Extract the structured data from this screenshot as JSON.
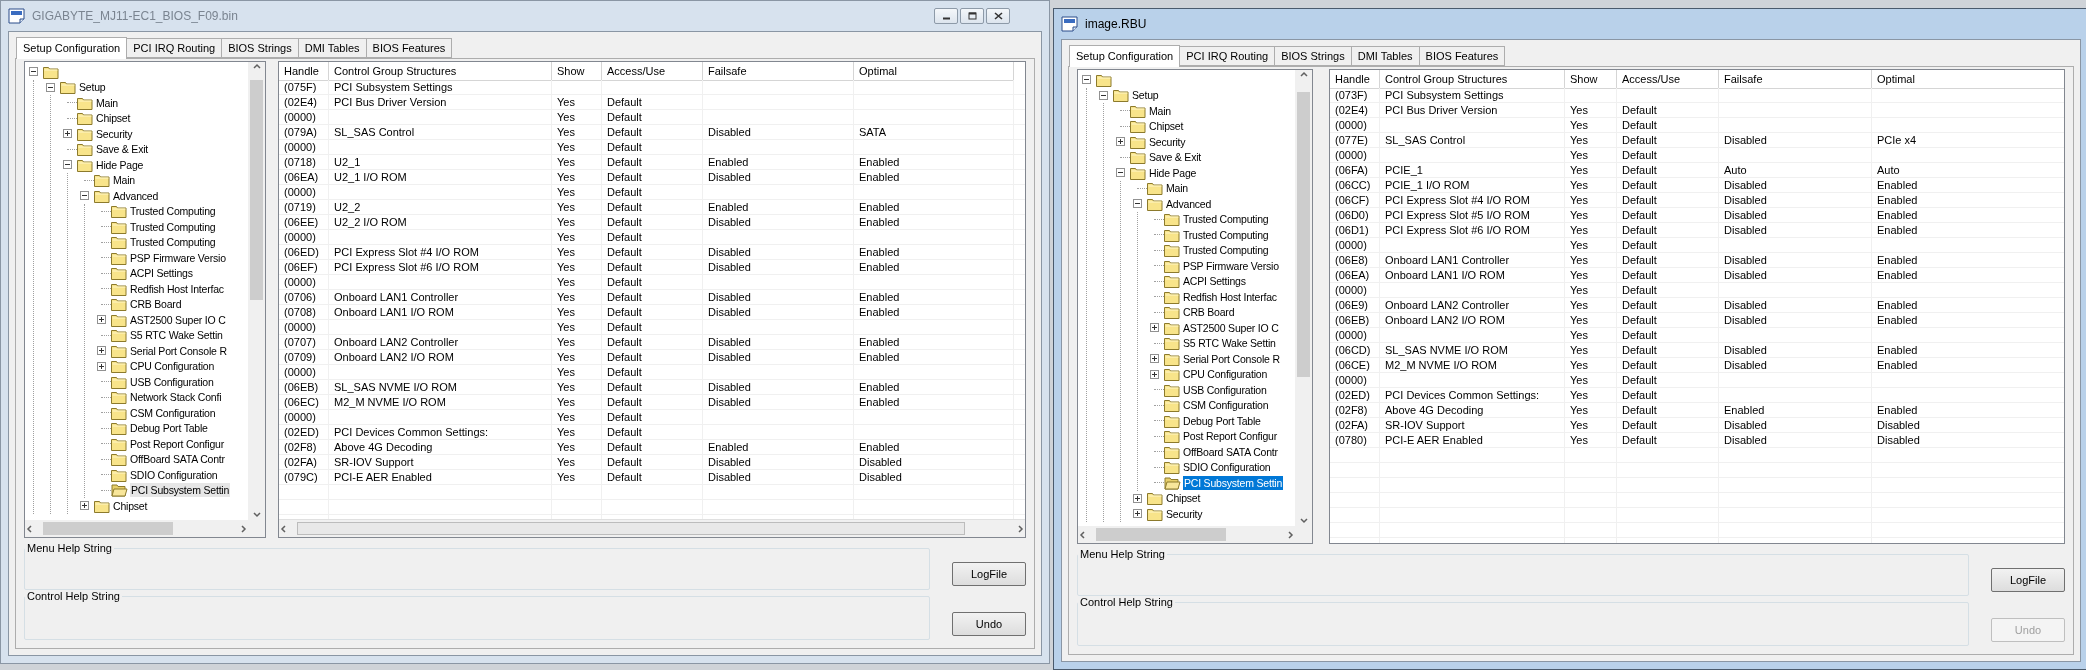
{
  "windows": [
    {
      "title": "GIGABYTE_MJ11-EC1_BIOS_F09.bin",
      "active": false,
      "has_controls": true,
      "horizontal_scrollbar": true,
      "tabs": [
        {
          "label": "Setup Configuration",
          "selected": true
        },
        {
          "label": "PCI IRQ Routing",
          "selected": false
        },
        {
          "label": "BIOS Strings",
          "selected": false
        },
        {
          "label": "DMI Tables",
          "selected": false
        },
        {
          "label": "BIOS Features",
          "selected": false
        }
      ],
      "tree": [
        {
          "selected": false,
          "expanded": true,
          "children": [
            {
              "label": "Setup",
              "selected": false,
              "expanded": true,
              "children": [
                {
                  "label": "Main",
                  "selected": false
                },
                {
                  "label": "Chipset",
                  "selected": false
                },
                {
                  "label": "Security",
                  "selected": false,
                  "expanded": false
                },
                {
                  "label": "Save & Exit",
                  "selected": false
                },
                {
                  "label": "Hide Page",
                  "selected": false,
                  "expanded": true,
                  "children": [
                    {
                      "label": "Main",
                      "selected": false
                    },
                    {
                      "label": "Advanced",
                      "selected": false,
                      "expanded": true,
                      "children": [
                        {
                          "label": "Trusted Computing",
                          "selected": false
                        },
                        {
                          "label": "Trusted Computing",
                          "selected": false
                        },
                        {
                          "label": "Trusted Computing",
                          "selected": false
                        },
                        {
                          "label": "PSP Firmware Versio",
                          "selected": false
                        },
                        {
                          "label": "ACPI Settings",
                          "selected": false
                        },
                        {
                          "label": "Redfish Host Interfac",
                          "selected": false
                        },
                        {
                          "label": "CRB Board",
                          "selected": false
                        },
                        {
                          "label": "AST2500 Super IO C",
                          "selected": false,
                          "expanded": false
                        },
                        {
                          "label": "S5 RTC Wake Settin",
                          "selected": false
                        },
                        {
                          "label": "Serial Port Console R",
                          "selected": false,
                          "expanded": false
                        },
                        {
                          "label": "CPU Configuration",
                          "selected": false,
                          "expanded": false
                        },
                        {
                          "label": "USB Configuration",
                          "selected": false
                        },
                        {
                          "label": "Network Stack Confi",
                          "selected": false
                        },
                        {
                          "label": "CSM Configuration",
                          "selected": false
                        },
                        {
                          "label": "Debug Port Table",
                          "selected": false
                        },
                        {
                          "label": "Post Report Configur",
                          "selected": false
                        },
                        {
                          "label": "OffBoard SATA Contr",
                          "selected": false
                        },
                        {
                          "label": "SDIO Configuration",
                          "selected": false
                        },
                        {
                          "label": "PCI Subsystem Settin",
                          "selected": true
                        }
                      ]
                    },
                    {
                      "label": "Chipset",
                      "selected": false,
                      "expanded": false
                    }
                  ]
                }
              ]
            }
          ]
        }
      ],
      "table": {
        "columns": [
          "Handle",
          "Control Group Structures",
          "Show",
          "Access/Use",
          "Failsafe",
          "Optimal"
        ],
        "rows": [
          {
            "handle": "(075F)",
            "structure": "PCI Subsystem Settings"
          },
          {
            "handle": "(02E4)",
            "structure": "PCI Bus Driver Version",
            "show": "Yes",
            "access": "Default"
          },
          {
            "handle": "(0000)",
            "show": "Yes",
            "access": "Default"
          },
          {
            "handle": "(079A)",
            "structure": "SL_SAS Control",
            "show": "Yes",
            "access": "Default",
            "failsafe": "Disabled",
            "optimal": "SATA"
          },
          {
            "handle": "(0000)",
            "show": "Yes",
            "access": "Default"
          },
          {
            "handle": "(0718)",
            "structure": "U2_1",
            "show": "Yes",
            "access": "Default",
            "failsafe": "Enabled",
            "optimal": "Enabled"
          },
          {
            "handle": "(06EA)",
            "structure": "U2_1 I/O ROM",
            "show": "Yes",
            "access": "Default",
            "failsafe": "Disabled",
            "optimal": "Enabled"
          },
          {
            "handle": "(0000)",
            "show": "Yes",
            "access": "Default"
          },
          {
            "handle": "(0719)",
            "structure": "U2_2",
            "show": "Yes",
            "access": "Default",
            "failsafe": "Enabled",
            "optimal": "Enabled"
          },
          {
            "handle": "(06EE)",
            "structure": "U2_2 I/O ROM",
            "show": "Yes",
            "access": "Default",
            "failsafe": "Disabled",
            "optimal": "Enabled"
          },
          {
            "handle": "(0000)",
            "show": "Yes",
            "access": "Default"
          },
          {
            "handle": "(06ED)",
            "structure": "PCI Express Slot #4 I/O ROM",
            "show": "Yes",
            "access": "Default",
            "failsafe": "Disabled",
            "optimal": "Enabled"
          },
          {
            "handle": "(06EF)",
            "structure": "PCI Express Slot #6 I/O ROM",
            "show": "Yes",
            "access": "Default",
            "failsafe": "Disabled",
            "optimal": "Enabled"
          },
          {
            "handle": "(0000)",
            "show": "Yes",
            "access": "Default"
          },
          {
            "handle": "(0706)",
            "structure": "Onboard LAN1 Controller",
            "show": "Yes",
            "access": "Default",
            "failsafe": "Disabled",
            "optimal": "Enabled"
          },
          {
            "handle": "(0708)",
            "structure": "Onboard LAN1 I/O ROM",
            "show": "Yes",
            "access": "Default",
            "failsafe": "Disabled",
            "optimal": "Enabled"
          },
          {
            "handle": "(0000)",
            "show": "Yes",
            "access": "Default"
          },
          {
            "handle": "(0707)",
            "structure": "Onboard LAN2 Controller",
            "show": "Yes",
            "access": "Default",
            "failsafe": "Disabled",
            "optimal": "Enabled"
          },
          {
            "handle": "(0709)",
            "structure": "Onboard LAN2 I/O ROM",
            "show": "Yes",
            "access": "Default",
            "failsafe": "Disabled",
            "optimal": "Enabled"
          },
          {
            "handle": "(0000)",
            "show": "Yes",
            "access": "Default"
          },
          {
            "handle": "(06EB)",
            "structure": "SL_SAS NVME I/O ROM",
            "show": "Yes",
            "access": "Default",
            "failsafe": "Disabled",
            "optimal": "Enabled"
          },
          {
            "handle": "(06EC)",
            "structure": "M2_M NVME I/O ROM",
            "show": "Yes",
            "access": "Default",
            "failsafe": "Disabled",
            "optimal": "Enabled"
          },
          {
            "handle": "(0000)",
            "show": "Yes",
            "access": "Default"
          },
          {
            "handle": "(02ED)",
            "structure": "PCI Devices Common Settings:",
            "show": "Yes",
            "access": "Default"
          },
          {
            "handle": "(02F8)",
            "structure": "Above 4G Decoding",
            "show": "Yes",
            "access": "Default",
            "failsafe": "Enabled",
            "optimal": "Enabled"
          },
          {
            "handle": "(02FA)",
            "structure": "SR-IOV Support",
            "show": "Yes",
            "access": "Default",
            "failsafe": "Disabled",
            "optimal": "Disabled"
          },
          {
            "handle": "(079C)",
            "structure": "PCI-E AER Enabled",
            "show": "Yes",
            "access": "Default",
            "failsafe": "Disabled",
            "optimal": "Disabled"
          }
        ]
      },
      "groups": [
        "Menu Help String",
        "Control Help String"
      ],
      "buttons": [
        {
          "label": "LogFile",
          "disabled": false
        },
        {
          "label": "Undo",
          "disabled": false
        }
      ]
    },
    {
      "title": "image.RBU",
      "active": true,
      "has_controls": false,
      "horizontal_scrollbar": false,
      "tabs": [
        {
          "label": "Setup Configuration",
          "selected": true
        },
        {
          "label": "PCI IRQ Routing",
          "selected": false
        },
        {
          "label": "BIOS Strings",
          "selected": false
        },
        {
          "label": "DMI Tables",
          "selected": false
        },
        {
          "label": "BIOS Features",
          "selected": false
        }
      ],
      "tree": [
        {
          "selected": false,
          "expanded": true,
          "children": [
            {
              "label": "Setup",
              "selected": false,
              "expanded": true,
              "children": [
                {
                  "label": "Main",
                  "selected": false
                },
                {
                  "label": "Chipset",
                  "selected": false
                },
                {
                  "label": "Security",
                  "selected": false,
                  "expanded": false
                },
                {
                  "label": "Save & Exit",
                  "selected": false
                },
                {
                  "label": "Hide Page",
                  "selected": false,
                  "expanded": true,
                  "children": [
                    {
                      "label": "Main",
                      "selected": false
                    },
                    {
                      "label": "Advanced",
                      "selected": false,
                      "expanded": true,
                      "children": [
                        {
                          "label": "Trusted Computing",
                          "selected": false
                        },
                        {
                          "label": "Trusted Computing",
                          "selected": false
                        },
                        {
                          "label": "Trusted Computing",
                          "selected": false
                        },
                        {
                          "label": "PSP Firmware Versio",
                          "selected": false
                        },
                        {
                          "label": "ACPI Settings",
                          "selected": false
                        },
                        {
                          "label": "Redfish Host Interfac",
                          "selected": false
                        },
                        {
                          "label": "CRB Board",
                          "selected": false
                        },
                        {
                          "label": "AST2500 Super IO C",
                          "selected": false,
                          "expanded": false
                        },
                        {
                          "label": "S5 RTC Wake Settin",
                          "selected": false
                        },
                        {
                          "label": "Serial Port Console R",
                          "selected": false,
                          "expanded": false
                        },
                        {
                          "label": "CPU Configuration",
                          "selected": false,
                          "expanded": false
                        },
                        {
                          "label": "USB Configuration",
                          "selected": false
                        },
                        {
                          "label": "CSM Configuration",
                          "selected": false
                        },
                        {
                          "label": "Debug Port Table",
                          "selected": false
                        },
                        {
                          "label": "Post Report Configur",
                          "selected": false
                        },
                        {
                          "label": "OffBoard SATA Contr",
                          "selected": false
                        },
                        {
                          "label": "SDIO Configuration",
                          "selected": false
                        },
                        {
                          "label": "PCI Subsystem Settin",
                          "selected": true
                        }
                      ]
                    },
                    {
                      "label": "Chipset",
                      "selected": false,
                      "expanded": false
                    },
                    {
                      "label": "Security",
                      "selected": false,
                      "expanded": false
                    }
                  ]
                }
              ]
            }
          ]
        }
      ],
      "table": {
        "columns": [
          "Handle",
          "Control Group Structures",
          "Show",
          "Access/Use",
          "Failsafe",
          "Optimal"
        ],
        "rows": [
          {
            "handle": "(073F)",
            "structure": "PCI Subsystem Settings"
          },
          {
            "handle": "(02E4)",
            "structure": "PCI Bus Driver Version",
            "show": "Yes",
            "access": "Default"
          },
          {
            "handle": "(0000)",
            "show": "Yes",
            "access": "Default"
          },
          {
            "handle": "(077E)",
            "structure": "SL_SAS Control",
            "show": "Yes",
            "access": "Default",
            "failsafe": "Disabled",
            "optimal": "PCIe x4"
          },
          {
            "handle": "(0000)",
            "show": "Yes",
            "access": "Default"
          },
          {
            "handle": "(06FA)",
            "structure": "PCIE_1",
            "show": "Yes",
            "access": "Default",
            "failsafe": "Auto",
            "optimal": "Auto"
          },
          {
            "handle": "(06CC)",
            "structure": "PCIE_1 I/O ROM",
            "show": "Yes",
            "access": "Default",
            "failsafe": "Disabled",
            "optimal": "Enabled"
          },
          {
            "handle": "(06CF)",
            "structure": "PCI Express Slot #4 I/O ROM",
            "show": "Yes",
            "access": "Default",
            "failsafe": "Disabled",
            "optimal": "Enabled"
          },
          {
            "handle": "(06D0)",
            "structure": "PCI Express Slot #5 I/O ROM",
            "show": "Yes",
            "access": "Default",
            "failsafe": "Disabled",
            "optimal": "Enabled"
          },
          {
            "handle": "(06D1)",
            "structure": "PCI Express Slot #6 I/O ROM",
            "show": "Yes",
            "access": "Default",
            "failsafe": "Disabled",
            "optimal": "Enabled"
          },
          {
            "handle": "(0000)",
            "show": "Yes",
            "access": "Default"
          },
          {
            "handle": "(06E8)",
            "structure": "Onboard LAN1 Controller",
            "show": "Yes",
            "access": "Default",
            "failsafe": "Disabled",
            "optimal": "Enabled"
          },
          {
            "handle": "(06EA)",
            "structure": "Onboard LAN1 I/O ROM",
            "show": "Yes",
            "access": "Default",
            "failsafe": "Disabled",
            "optimal": "Enabled"
          },
          {
            "handle": "(0000)",
            "show": "Yes",
            "access": "Default"
          },
          {
            "handle": "(06E9)",
            "structure": "Onboard LAN2 Controller",
            "show": "Yes",
            "access": "Default",
            "failsafe": "Disabled",
            "optimal": "Enabled"
          },
          {
            "handle": "(06EB)",
            "structure": "Onboard LAN2 I/O ROM",
            "show": "Yes",
            "access": "Default",
            "failsafe": "Disabled",
            "optimal": "Enabled"
          },
          {
            "handle": "(0000)",
            "show": "Yes",
            "access": "Default"
          },
          {
            "handle": "(06CD)",
            "structure": "SL_SAS NVME I/O ROM",
            "show": "Yes",
            "access": "Default",
            "failsafe": "Disabled",
            "optimal": "Enabled"
          },
          {
            "handle": "(06CE)",
            "structure": "M2_M NVME I/O ROM",
            "show": "Yes",
            "access": "Default",
            "failsafe": "Disabled",
            "optimal": "Enabled"
          },
          {
            "handle": "(0000)",
            "show": "Yes",
            "access": "Default"
          },
          {
            "handle": "(02ED)",
            "structure": "PCI Devices Common Settings:",
            "show": "Yes",
            "access": "Default"
          },
          {
            "handle": "(02F8)",
            "structure": "Above 4G Decoding",
            "show": "Yes",
            "access": "Default",
            "failsafe": "Enabled",
            "optimal": "Enabled"
          },
          {
            "handle": "(02FA)",
            "structure": "SR-IOV Support",
            "show": "Yes",
            "access": "Default",
            "failsafe": "Disabled",
            "optimal": "Disabled"
          },
          {
            "handle": "(0780)",
            "structure": "PCI-E AER Enabled",
            "show": "Yes",
            "access": "Default",
            "failsafe": "Disabled",
            "optimal": "Disabled"
          }
        ]
      },
      "groups": [
        "Menu Help String",
        "Control Help String"
      ],
      "buttons": [
        {
          "label": "LogFile",
          "disabled": false
        },
        {
          "label": "Undo",
          "disabled": true
        }
      ]
    }
  ]
}
